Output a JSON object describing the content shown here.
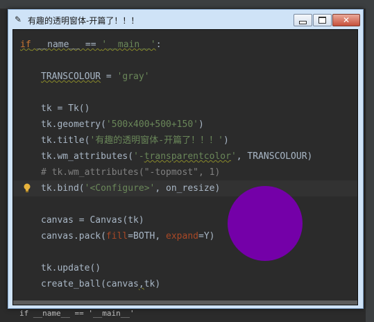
{
  "window": {
    "title": "有趣的透明窗体-开篇了！！！",
    "icon": "feather-icon",
    "controls": {
      "minimize": "minimize-icon",
      "maximize": "maximize-icon",
      "close": "close-icon"
    }
  },
  "code": {
    "line1": {
      "kw": "if",
      "a": " __name__ == ",
      "s": "'__main__'",
      "b": ":"
    },
    "line2": {
      "name": "TRANSCOLOUR",
      "a": " = ",
      "s": "'gray'"
    },
    "line3": {
      "text": "tk = Tk()"
    },
    "line4": {
      "a": "tk.geometry(",
      "s": "'500x400+500+150'",
      "b": ")"
    },
    "line5": {
      "a": "tk.title(",
      "s": "'有趣的透明窗体-开篇了！！！'",
      "b": ")"
    },
    "line6": {
      "a": "tk.wm_attributes(",
      "s1": "'-",
      "s2": "transparentcolor",
      "s3": "'",
      "b": ", TRANSCOLOUR)"
    },
    "line7": {
      "text": "# tk.wm_attributes(\"-topmost\", 1)"
    },
    "line8": {
      "a": "tk.bind(",
      "s": "'<Configure>'",
      "b": ", on_resize)"
    },
    "line9": {
      "text": "canvas = Canvas(tk)"
    },
    "line10": {
      "a": "canvas.pack(",
      "p1": "fill",
      "b": "=BOTH, ",
      "p2": "expand",
      "c": "=Y)"
    },
    "line11": {
      "text": "tk.update()"
    },
    "line12": {
      "a": "create_ball(canvas",
      "b": ",",
      "c": "tk)"
    }
  },
  "gutter": {
    "intention_icon": "lightbulb-icon"
  },
  "ball": {
    "color": "#7400a8"
  },
  "status": {
    "breadcrumb": "if __name__ == '__main__'"
  },
  "colors": {
    "keyword": "#cc7832",
    "string": "#6a8759",
    "comment": "#808080",
    "param": "#aa4926",
    "text": "#a9b7c6",
    "background": "#2b2b2b"
  }
}
